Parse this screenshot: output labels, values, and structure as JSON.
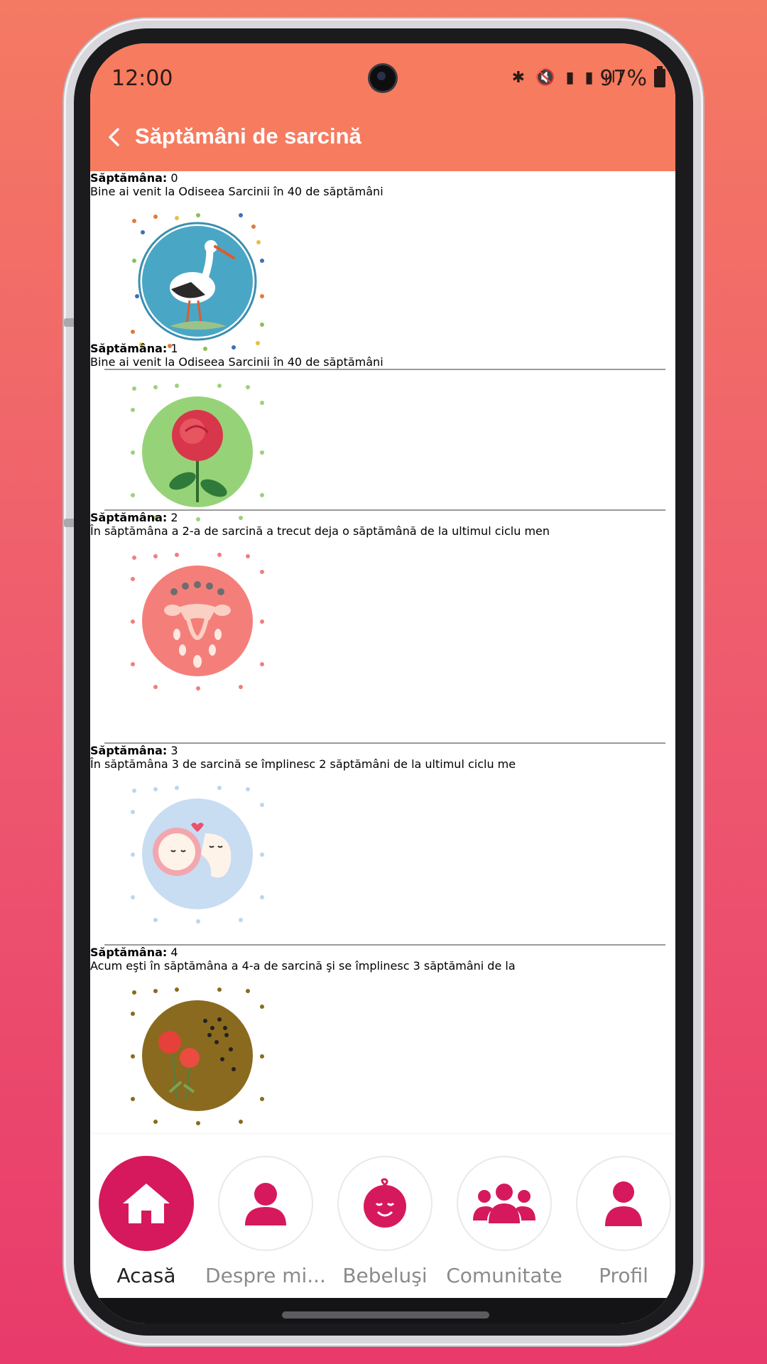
{
  "status_bar": {
    "time": "12:00",
    "battery": "97%"
  },
  "header": {
    "title": "Săptămâni de sarcină"
  },
  "weeks": [
    {
      "label": "Săptămâna:",
      "number": "0",
      "desc": "Bine ai venit la Odiseea Sarcinii în 40 de săptămâni"
    },
    {
      "label": "Săptămâna:",
      "number": "1",
      "desc": "Bine ai venit la Odiseea Sarcinii în 40 de săptămâni"
    },
    {
      "label": "Săptămâna:",
      "number": "2",
      "desc": "În săptămâna a 2-a de sarcină a trecut deja o săptămână de la ultimul ciclu men"
    },
    {
      "label": "Săptămâna:",
      "number": "3",
      "desc": "În săptămâna 3 de sarcină se împlinesc 2 săptămâni de la ultimul ciclu me"
    },
    {
      "label": "Săptămâna:",
      "number": "4",
      "desc": "Acum eşti în săptămâna a 4-a de sarcină şi se împlinesc 3 săptămâni de la"
    }
  ],
  "nav": [
    {
      "label": "Acasă",
      "icon": "home-icon",
      "active": true
    },
    {
      "label": "Despre mi...",
      "icon": "person-icon",
      "active": false
    },
    {
      "label": "Bebeluşi",
      "icon": "baby-icon",
      "active": false
    },
    {
      "label": "Comunitate",
      "icon": "group-icon",
      "active": false
    },
    {
      "label": "Profil",
      "icon": "profile-icon",
      "active": false
    }
  ],
  "colors": {
    "header": "#f77b5f",
    "accent": "#d6195c"
  }
}
